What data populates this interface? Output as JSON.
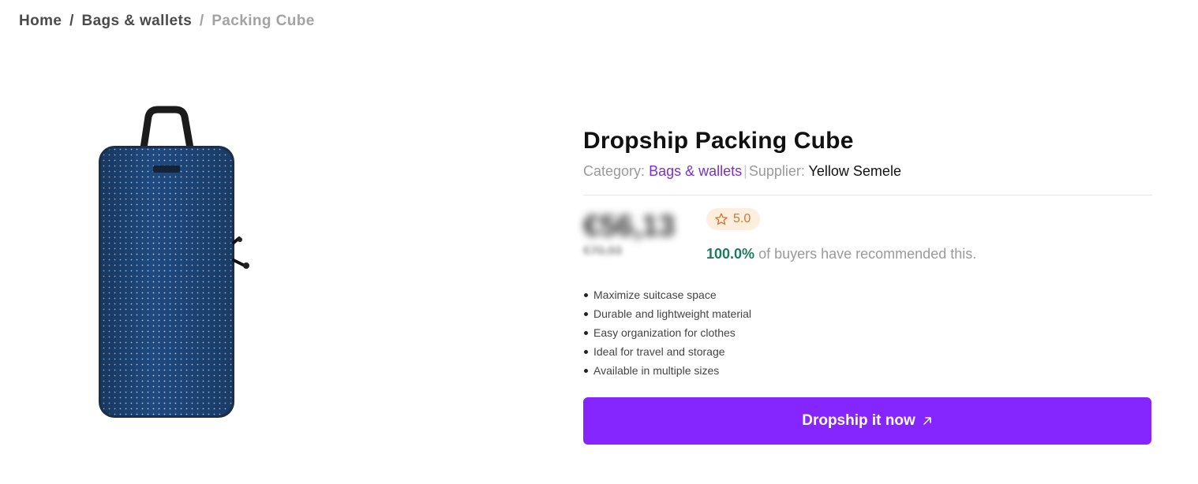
{
  "breadcrumb": {
    "home": "Home",
    "separator": "/",
    "category": "Bags & wallets",
    "current": "Packing Cube"
  },
  "product": {
    "title": "Dropship Packing Cube",
    "category_label": "Category:",
    "category": "Bags & wallets",
    "supplier_label": "Supplier:",
    "supplier": "Yellow Semele",
    "divider": "|",
    "price": "€56,13",
    "old_price": "€70,93",
    "rating": "5.0",
    "recommend_pct": "100.0%",
    "recommend_text": "of buyers have recommended this.",
    "features": [
      "Maximize suitcase space",
      "Durable and lightweight material",
      "Easy organization for clothes",
      "Ideal for travel and storage",
      "Available in multiple sizes"
    ],
    "cta_label": "Dropship it now",
    "image_icon": "packing-cube-bag-icon",
    "cta_icon": "arrow-up-right-icon",
    "rating_icon": "star-outline-icon"
  },
  "colors": {
    "accent": "#8526ff",
    "link": "#7a2fd6",
    "rating_bg": "#fdeedd",
    "rating_fg": "#d9742a",
    "recommend": "#1d7a5f"
  }
}
